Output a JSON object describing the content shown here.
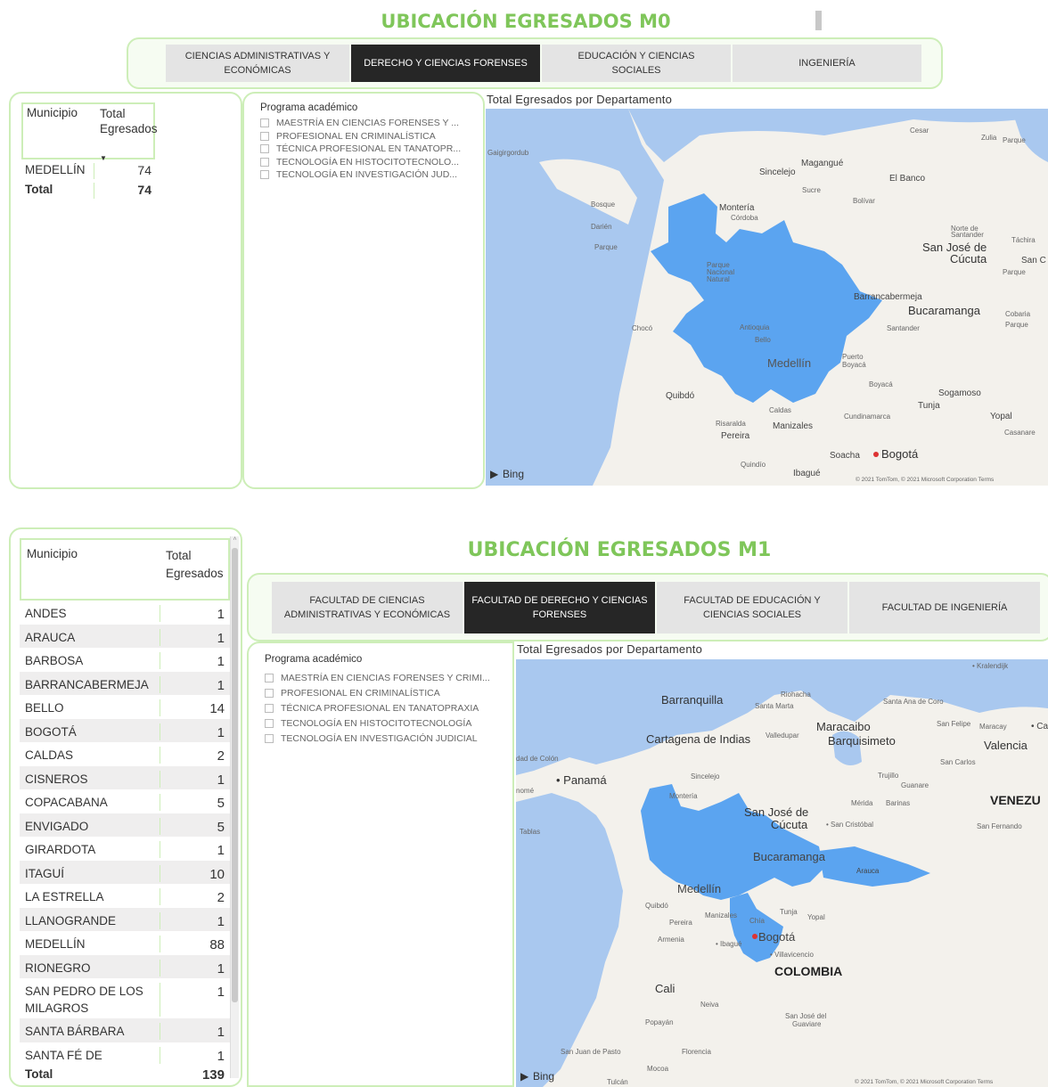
{
  "m0": {
    "title": "UBICACIÓN EGRESADOS M0",
    "tabs": [
      {
        "label": "CIENCIAS ADMINISTRATIVAS Y ECONÓMICAS",
        "active": false
      },
      {
        "label": "DERECHO Y CIENCIAS FORENSES",
        "active": true
      },
      {
        "label": "EDUCACIÓN Y CIENCIAS SOCIALES",
        "active": false
      },
      {
        "label": "INGENIERÍA",
        "active": false
      }
    ],
    "table": {
      "col_municipio": "Municipio",
      "col_total": "Total Egresados",
      "rows": [
        {
          "municipio": "MEDELLÍN",
          "total": "74"
        }
      ],
      "total_label": "Total",
      "total_value": "74"
    },
    "slicer": {
      "title": "Programa académico",
      "items": [
        "MAESTRÍA EN CIENCIAS FORENSES Y ...",
        "PROFESIONAL EN CRIMINALÍSTICA",
        "TÉCNICA PROFESIONAL EN TANATOPR...",
        "TECNOLOGÍA EN HISTOCITOTECNOLO...",
        "TECNOLOGÍA EN INVESTIGACIÓN JUD..."
      ]
    },
    "map": {
      "title": "Total Egresados por Departamento",
      "attribution": "Bing",
      "copyright": "© 2021 TomTom, © 2021 Microsoft Corporation  Terms",
      "labels": [
        "Gaigirgordub",
        "Sincelejo",
        "Magangué",
        "El Banco",
        "Montería",
        "Córdoba",
        "Sucre",
        "Bolívar",
        "Cesar",
        "Zulia",
        "Bosque Protector Alto Darién",
        "Parque Nacional Darién",
        "Parque Nacional Natural Paramillo",
        "Norte de Santander",
        "San José de Cúcuta",
        "Táchira",
        "Barrancabermeja",
        "Bucaramanga",
        "Santander",
        "Chocó",
        "Antioquia",
        "Bello",
        "Medellín",
        "Puerto Boyacá",
        "Boyacá",
        "Quibdó",
        "Caldas",
        "Manizales",
        "Risaralda",
        "Pereira",
        "Cundinamarca",
        "Tunja",
        "Sogamoso",
        "Yopal",
        "Casanare",
        "Soacha",
        "Bogotá",
        "Quindío",
        "Ibagué",
        "Parque Nacional Ciénagas de Juan Manuel",
        "Parque Nacional Natural El Tamá",
        "Cobaria",
        "Parque Nacional Natural El Cocuy",
        "San C"
      ]
    }
  },
  "m1": {
    "title": "UBICACIÓN EGRESADOS M1",
    "tabs": [
      {
        "label": "FACULTAD DE CIENCIAS ADMINISTRATIVAS Y ECONÓMICAS",
        "active": false
      },
      {
        "label": "FACULTAD DE DERECHO Y CIENCIAS FORENSES",
        "active": true
      },
      {
        "label": "FACULTAD DE EDUCACIÓN Y CIENCIAS SOCIALES",
        "active": false
      },
      {
        "label": "FACULTAD DE INGENIERÍA",
        "active": false
      }
    ],
    "table": {
      "col_municipio": "Municipio",
      "col_total": "Total Egresados",
      "rows": [
        {
          "municipio": "ANDES",
          "total": "1"
        },
        {
          "municipio": "ARAUCA",
          "total": "1"
        },
        {
          "municipio": "BARBOSA",
          "total": "1"
        },
        {
          "municipio": "BARRANCABERMEJA",
          "total": "1"
        },
        {
          "municipio": "BELLO",
          "total": "14"
        },
        {
          "municipio": "BOGOTÁ",
          "total": "1"
        },
        {
          "municipio": "CALDAS",
          "total": "2"
        },
        {
          "municipio": "CISNEROS",
          "total": "1"
        },
        {
          "municipio": "COPACABANA",
          "total": "5"
        },
        {
          "municipio": "ENVIGADO",
          "total": "5"
        },
        {
          "municipio": "GIRARDOTA",
          "total": "1"
        },
        {
          "municipio": "ITAGUÍ",
          "total": "10"
        },
        {
          "municipio": "LA ESTRELLA",
          "total": "2"
        },
        {
          "municipio": "LLANOGRANDE",
          "total": "1"
        },
        {
          "municipio": "MEDELLÍN",
          "total": "88"
        },
        {
          "municipio": "RIONEGRO",
          "total": "1"
        },
        {
          "municipio": "SAN PEDRO DE LOS MILAGROS",
          "total": "1"
        },
        {
          "municipio": "SANTA BÁRBARA",
          "total": "1"
        },
        {
          "municipio": "SANTA FÉ DE",
          "total": "1"
        }
      ],
      "total_label": "Total",
      "total_value": "139"
    },
    "slicer": {
      "title": "Programa académico",
      "items": [
        "MAESTRÍA EN CIENCIAS FORENSES Y CRIMI...",
        "PROFESIONAL EN CRIMINALÍSTICA",
        "TÉCNICA PROFESIONAL EN TANATOPRAXIA",
        "TECNOLOGÍA EN HISTOCITOTECNOLOGÍA",
        "TECNOLOGÍA EN INVESTIGACIÓN JUDICIAL"
      ]
    },
    "map": {
      "title": "Total Egresados por Departamento",
      "attribution": "Bing",
      "copyright": "© 2021 TomTom, © 2021 Microsoft Corporation  Terms",
      "labels": [
        "Kralendijk",
        "Barranquilla",
        "Riohacha",
        "Santa Marta",
        "Santa Ana de Coro",
        "Maracaibo",
        "San Felipe",
        "Maracay",
        "Car",
        "Cartagena de Indias",
        "Valledupar",
        "Barquisimeto",
        "Valencia",
        "dad de Colón",
        "San Carlos",
        "Trujillo",
        "Panamá",
        "Guanare",
        "Sincelejo",
        "nomé",
        "Montería",
        "Mérida",
        "Barinas",
        "VENEZU",
        "San José de Cúcuta",
        "San Cristóbal",
        "Tablas",
        "San Fernando",
        "Bucaramanga",
        "Arauca",
        "Medellín",
        "Quibdó",
        "Manizales",
        "Tunja",
        "Pereira",
        "Chía",
        "Yopal",
        "Armenia",
        "Ibagué",
        "Bogotá",
        "Villavicencio",
        "COLOMBIA",
        "Cali",
        "Neiva",
        "Popayán",
        "San José del Guaviare",
        "San Juan de Pasto",
        "Florencia",
        "Mocoa",
        "Tulcán"
      ]
    }
  },
  "colors": {
    "accent_green": "#7fc65a",
    "highlight_blue": "#5ba4f0",
    "water_blue": "#a9c8ef",
    "active_tab": "#262626"
  }
}
